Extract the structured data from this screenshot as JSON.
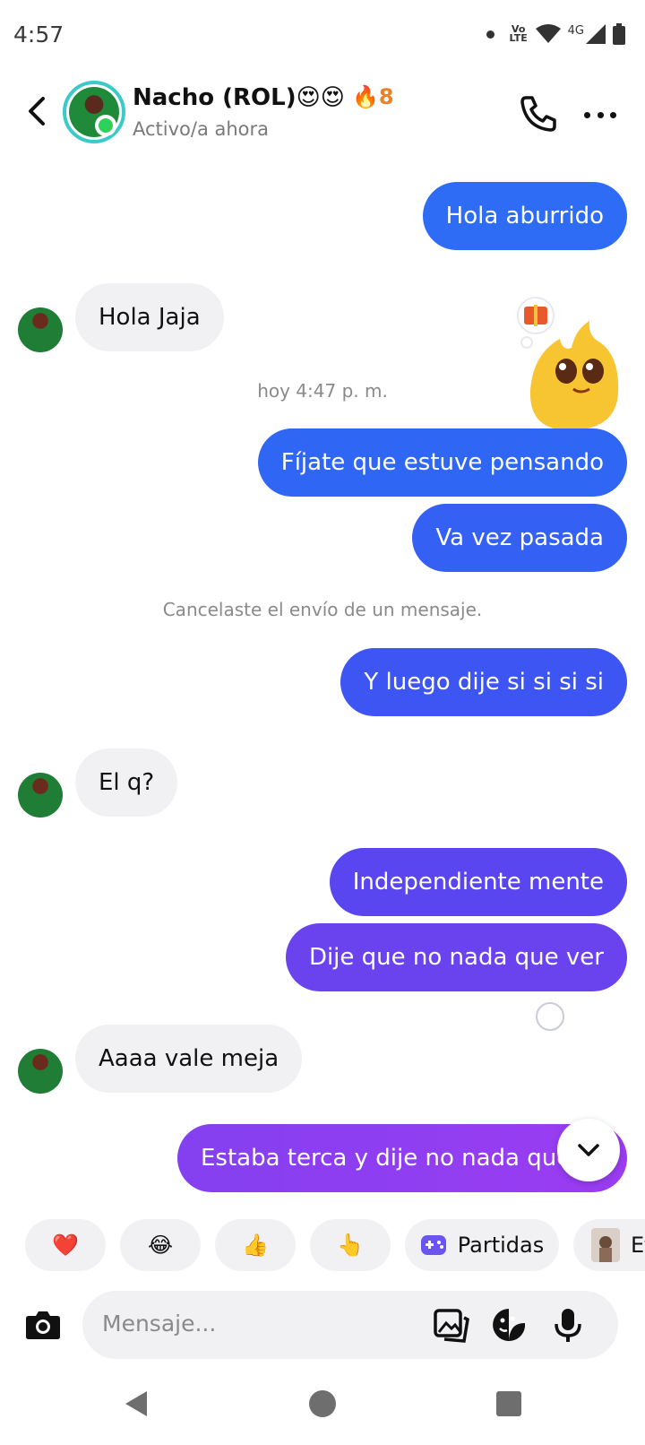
{
  "status_bar": {
    "time": "4:57",
    "volte": "Vo LTE",
    "network": "4G"
  },
  "header": {
    "name": "Nacho (ROL)😍😍",
    "streak": "🔥8",
    "status": "Activo/a ahora"
  },
  "messages": [
    {
      "dir": "out",
      "text": "Hola aburrido"
    },
    {
      "dir": "in",
      "text": "Hola Jaja"
    },
    {
      "dir": "system",
      "text": "hoy 4:47 p. m."
    },
    {
      "dir": "out",
      "text": "Fíjate que estuve pensando"
    },
    {
      "dir": "out",
      "text": "Va vez pasada"
    },
    {
      "dir": "system",
      "text": "Cancelaste el envío de un mensaje."
    },
    {
      "dir": "out",
      "text": "Y luego dije si si si si"
    },
    {
      "dir": "in",
      "text": "El q?"
    },
    {
      "dir": "out",
      "text": "Independiente mente"
    },
    {
      "dir": "out",
      "text": "Dije que no nada que ver"
    },
    {
      "dir": "in",
      "text": "Aaaa vale meja"
    },
    {
      "dir": "out",
      "text": "Estaba terca y dije no nada que"
    }
  ],
  "quick_replies": {
    "heart": "❤️",
    "laugh": "😂",
    "thumbs": "👍",
    "point": "👆",
    "games_label": "Partidas",
    "effects_label": "Ef"
  },
  "composer": {
    "placeholder": "Mensaje..."
  },
  "colors": {
    "bubble_in": "#f1f1f3",
    "bubble_out_start": "#2f6cf5",
    "bubble_out_end": "#9b3cf2",
    "online": "#2ed15a",
    "avatar_ring": "#3cc9c9"
  }
}
